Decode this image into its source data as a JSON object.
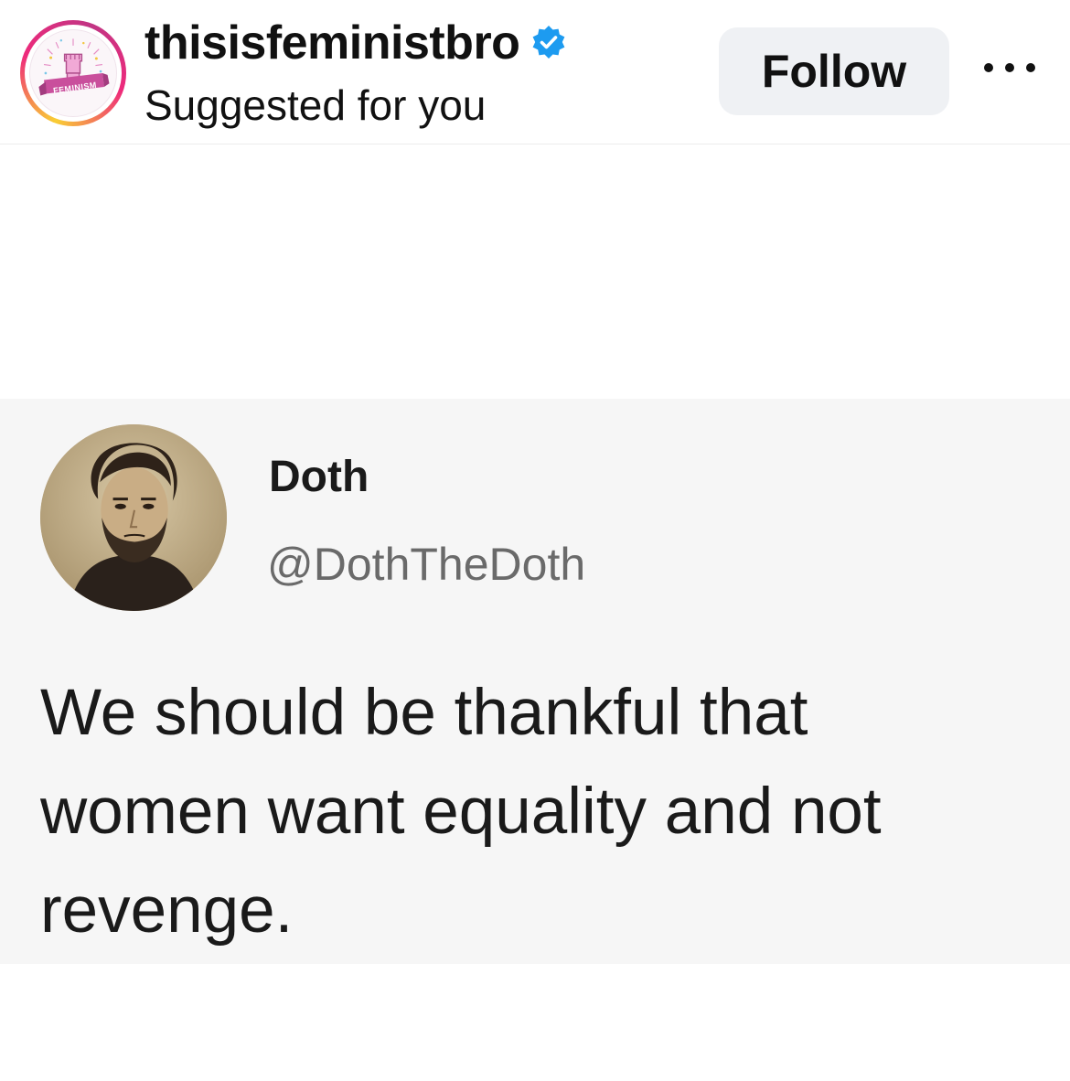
{
  "post": {
    "username": "thisisfeministbro",
    "verified": true,
    "subtitle": "Suggested for you",
    "follow_label": "Follow",
    "avatar_text": "FEMINISM",
    "colors": {
      "verified_blue": "#1d9bf0",
      "follow_bg": "#eff1f4",
      "ring_gradient": [
        "#f9ce34",
        "#ee2a7b",
        "#c13584"
      ]
    }
  },
  "tweet": {
    "name": "Doth",
    "handle": "@DothTheDoth",
    "text_lines": [
      "We should be thankful that",
      "women want equality and not",
      "revenge."
    ]
  }
}
